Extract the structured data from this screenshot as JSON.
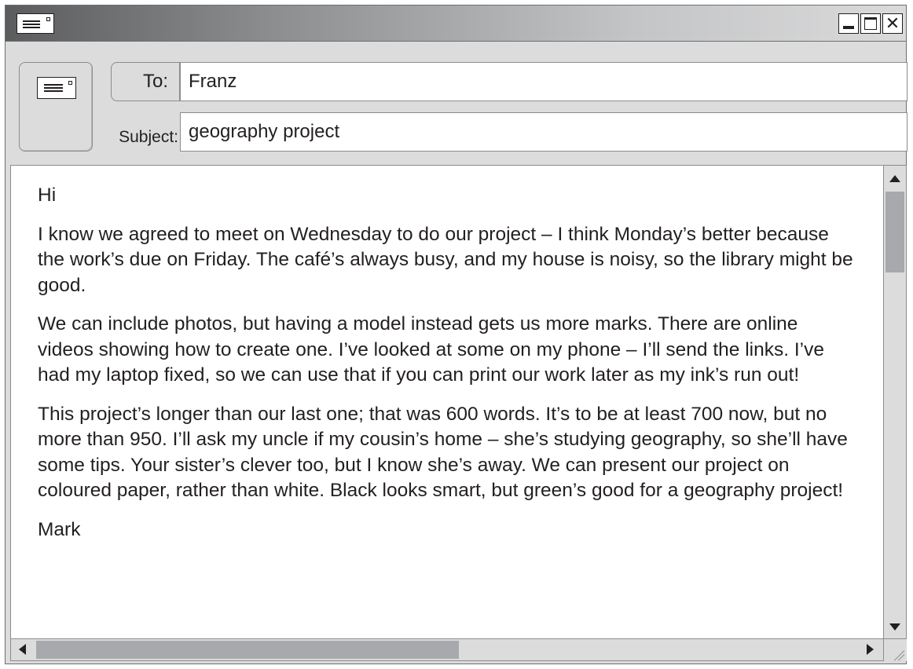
{
  "email": {
    "to_label": "To:",
    "to_value": "Franz",
    "subject_label": "Subject:",
    "subject_value": "geography project",
    "body": [
      "Hi",
      "I know we agreed to meet on Wednesday to do our project – I think Monday’s better because the work’s due on Friday. The café’s always busy, and my house is noisy, so the library might be good.",
      "We can include photos, but having a model instead gets us more marks. There are online videos showing how to create one. I’ve looked at some on my phone – I’ll send the links. I’ve had my laptop fixed, so we can use that if you can print our work later as my ink’s run out!",
      "This project’s longer than our last one; that was 600 words. It’s to be at least 700 now, but no more than 950. I’ll ask my uncle if my cousin’s home – she’s studying geography, so she’ll have some tips. Your sister’s clever too, but I know she’s away. We can present our project on coloured paper, rather than white. Black looks smart, but green’s good for a geography project!",
      "Mark"
    ]
  },
  "window_controls": {
    "close_glyph": "✕"
  },
  "icons": [
    "envelope-icon",
    "send-envelope-icon",
    "minimize-icon",
    "maximize-icon",
    "close-icon",
    "scroll-up-arrow-icon",
    "scroll-down-arrow-icon",
    "scroll-left-arrow-icon",
    "scroll-right-arrow-icon",
    "resize-grip-icon"
  ]
}
